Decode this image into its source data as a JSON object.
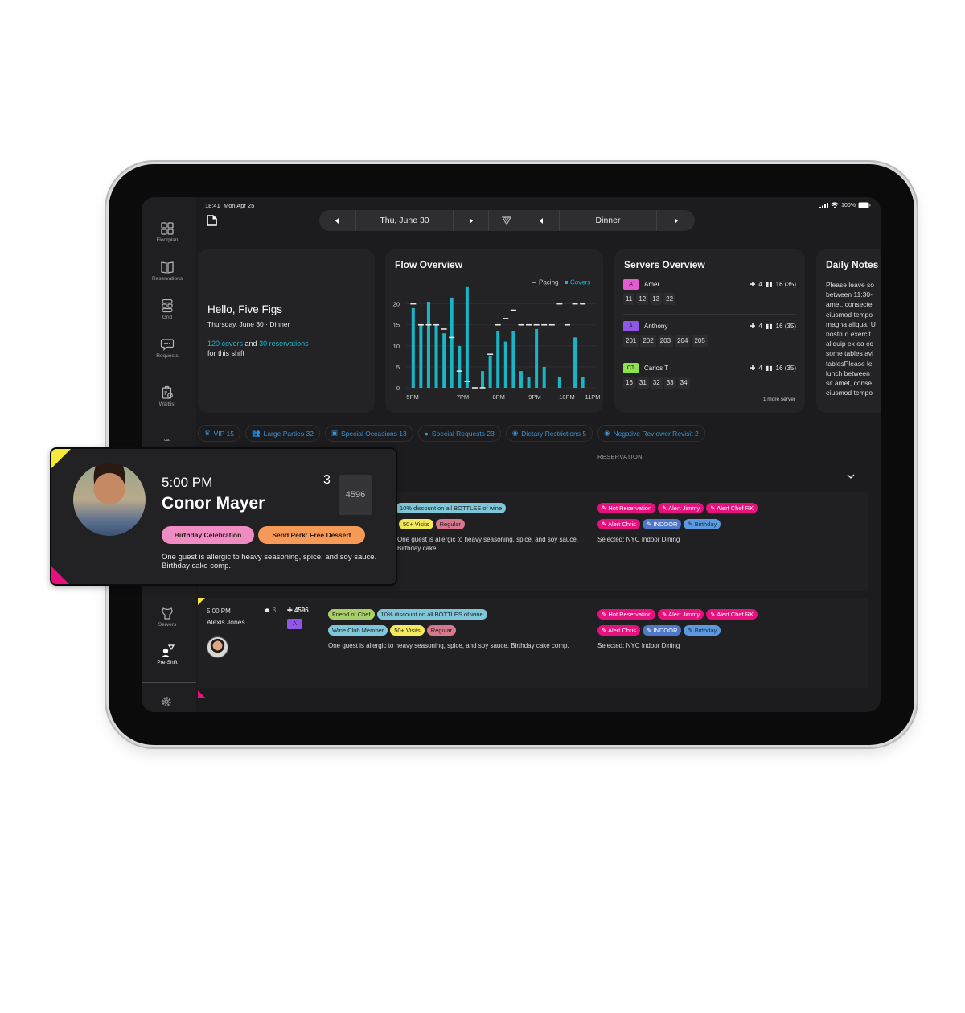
{
  "status_bar": {
    "time": "18:41",
    "date": "Mon Apr 25",
    "battery": "100%"
  },
  "sidebar": {
    "items": [
      {
        "label": "Floorplan",
        "icon": "grid-icon"
      },
      {
        "label": "Reservations",
        "icon": "book-icon"
      },
      {
        "label": "Grid",
        "icon": "tables-grid-icon"
      },
      {
        "label": "Requests",
        "icon": "chat-bubble-icon"
      },
      {
        "label": "Waitlist",
        "icon": "clipboard-icon"
      },
      {
        "label": "Servers",
        "icon": "server-apron-icon"
      },
      {
        "label": "Pre-Shift",
        "icon": "pre-shift-icon"
      }
    ],
    "settings_icon": "gear-icon"
  },
  "topnav": {
    "date_label": "Thu, June 30",
    "shift_label": "Dinner",
    "prev_icon": "caret-left-icon",
    "next_icon": "caret-right-icon",
    "logo_icon": "triangle-logo-icon"
  },
  "hello_card": {
    "greeting": "Hello, Five Figs",
    "subtitle": "Thursday, June 30 · Dinner",
    "covers": "120 covers",
    "and": "and",
    "reservations": "30 reservations",
    "suffix": "for this shift"
  },
  "flow_overview": {
    "title": "Flow Overview",
    "legend_pacing": "Pacing",
    "legend_covers": "Covers"
  },
  "chart_data": {
    "type": "bar",
    "title": "Flow Overview",
    "xlabel": "",
    "ylabel": "",
    "ylim": [
      0,
      23
    ],
    "yticks": [
      0,
      5,
      10,
      15,
      20
    ],
    "xtick_labels": [
      "5PM",
      "7PM",
      "8PM",
      "9PM",
      "10PM",
      "11PM"
    ],
    "grid": true,
    "legend": "top-right",
    "categories": [
      "5:00",
      "5:15",
      "5:30",
      "5:45",
      "6:00",
      "6:15",
      "6:30",
      "6:45",
      "7:00",
      "7:15",
      "7:30",
      "7:45",
      "8:00",
      "8:15",
      "8:30",
      "8:45",
      "9:00",
      "9:15",
      "9:30",
      "9:45",
      "10:00",
      "10:15",
      "10:30",
      "10:45"
    ],
    "series": [
      {
        "name": "Covers",
        "type": "bar",
        "color": "#19b5c7",
        "values": [
          19,
          15,
          20.5,
          15,
          13,
          21.5,
          10,
          24,
          0,
          4,
          7.5,
          13.5,
          11,
          13.5,
          4,
          2.5,
          14,
          5,
          0,
          2.5,
          0,
          12,
          2.5,
          0
        ]
      },
      {
        "name": "Pacing",
        "type": "marker",
        "color": "#e6e6e6",
        "values": [
          20,
          15,
          15,
          15,
          14,
          12,
          4,
          1.5,
          0,
          0,
          8,
          15,
          16.5,
          18.5,
          15,
          15,
          15,
          15,
          15,
          20,
          15,
          20,
          20,
          null
        ]
      }
    ]
  },
  "servers_overview": {
    "title": "Servers Overview",
    "servers": [
      {
        "initials": "A",
        "name": "Amer",
        "color": "#e45bd0",
        "guests": "4",
        "covers": "16 (35)",
        "tables": [
          "11",
          "12",
          "13",
          "22"
        ]
      },
      {
        "initials": "A",
        "name": "Anthony",
        "color": "#8f56e8",
        "guests": "4",
        "covers": "16 (35)",
        "tables": [
          "201",
          "202",
          "203",
          "204",
          "205"
        ]
      },
      {
        "initials": "CT",
        "name": "Carlos T",
        "color": "#8ee04c",
        "guests": "4",
        "covers": "16 (35)",
        "tables": [
          "16",
          "31",
          "32",
          "33",
          "34"
        ]
      }
    ],
    "more": "1 more server"
  },
  "daily_notes": {
    "title": "Daily Notes",
    "lines": [
      "Please leave so",
      "between 11:30-",
      "amet, consecte",
      "eiusmod tempo",
      "magna aliqua. U",
      "nostrud exercit",
      "aliquip ex ea co",
      "some tables avi",
      "tablesPlease le",
      "lunch between",
      "sit amet, conse",
      "eiusmod tempo"
    ]
  },
  "filters": [
    {
      "label": "VIP 15",
      "icon": "crown-icon"
    },
    {
      "label": "Large Parties 32",
      "icon": "group-icon"
    },
    {
      "label": "Special Occasions 13",
      "icon": "gift-icon"
    },
    {
      "label": "Special Requests 23",
      "icon": "speech-bubble-icon"
    },
    {
      "label": "Dietary Restrictions 5",
      "icon": "dietary-icon"
    },
    {
      "label": "Negative Reviewer Revisit 2",
      "icon": "thumbs-down-icon"
    }
  ],
  "list": {
    "column_header": "RESERVATION",
    "rows": [
      {
        "guest_tags": [
          "10% discount on all BOTTLES of wine",
          "50+ Visits",
          "Regular"
        ],
        "note": "One guest is allergic to heavy seasoning, spice, and soy sauce. Birthday cake",
        "res_tags": [
          "Hot Reservation",
          "Alert Jimmy",
          "Alert Chef RK",
          "Alert Chris",
          "INDOOR",
          "Birthday"
        ],
        "selected": "Selected: NYC Indoor Dining"
      },
      {
        "time": "5:00 PM",
        "name": "Alexis Jones",
        "party": "3",
        "table": "4596",
        "server_initial": "A",
        "guest_tags": [
          "Friend of Chef",
          "10% discount on all BOTTLES of wine",
          "Wine Club Member",
          "50+ Visits",
          "Regular"
        ],
        "note": "One guest is allergic to heavy seasoning, spice, and soy sauce. Birthday cake comp.",
        "res_tags": [
          "Hot Reservation",
          "Alert Jimmy",
          "Alert Chef RK",
          "Alert Chris",
          "INDOOR",
          "Birthday"
        ],
        "selected": "Selected: NYC Indoor Dining"
      }
    ]
  },
  "popup": {
    "time": "5:00 PM",
    "name": "Conor Mayer",
    "party": "3",
    "table": "4596",
    "pill_1": "Birthday Celebration",
    "pill_2": "Send Perk: Free Dessert",
    "note": "One guest is allergic to heavy seasoning, spice, and soy sauce. Birthday cake comp."
  }
}
